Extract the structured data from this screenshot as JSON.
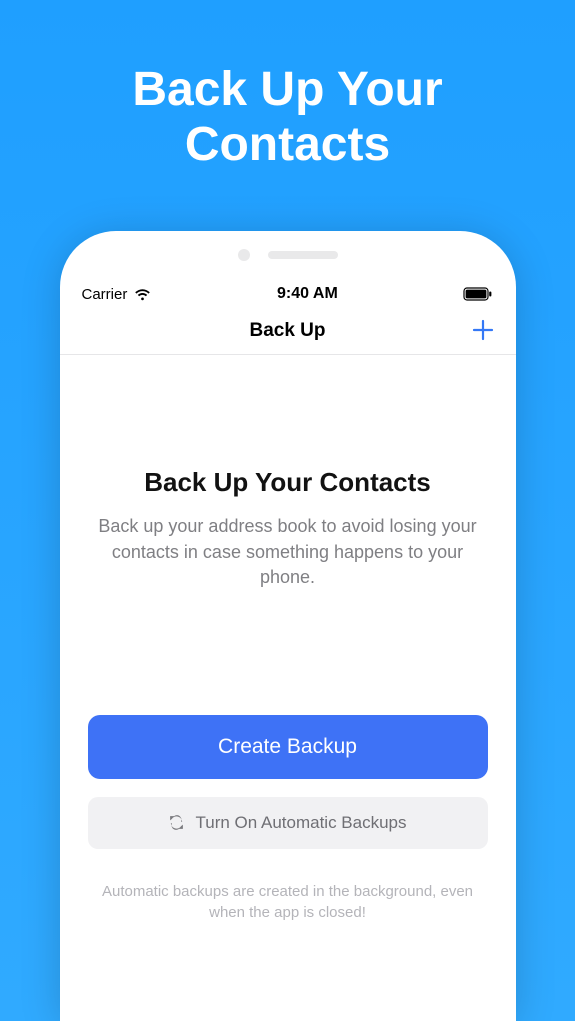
{
  "promo": {
    "title": "Back Up Your Contacts"
  },
  "statusbar": {
    "carrier": "Carrier",
    "time": "9:40 AM"
  },
  "navbar": {
    "title": "Back Up"
  },
  "main": {
    "heading": "Back Up Your Contacts",
    "subheading": "Back up your address book to avoid losing your contacts in case something happens to your phone.",
    "primary_label": "Create Backup",
    "secondary_label": "Turn On Automatic Backups",
    "footer": "Automatic backups are created in the background, even when the app is closed!"
  },
  "colors": {
    "accent": "#3e72f6",
    "bg": "#29a5ff"
  }
}
